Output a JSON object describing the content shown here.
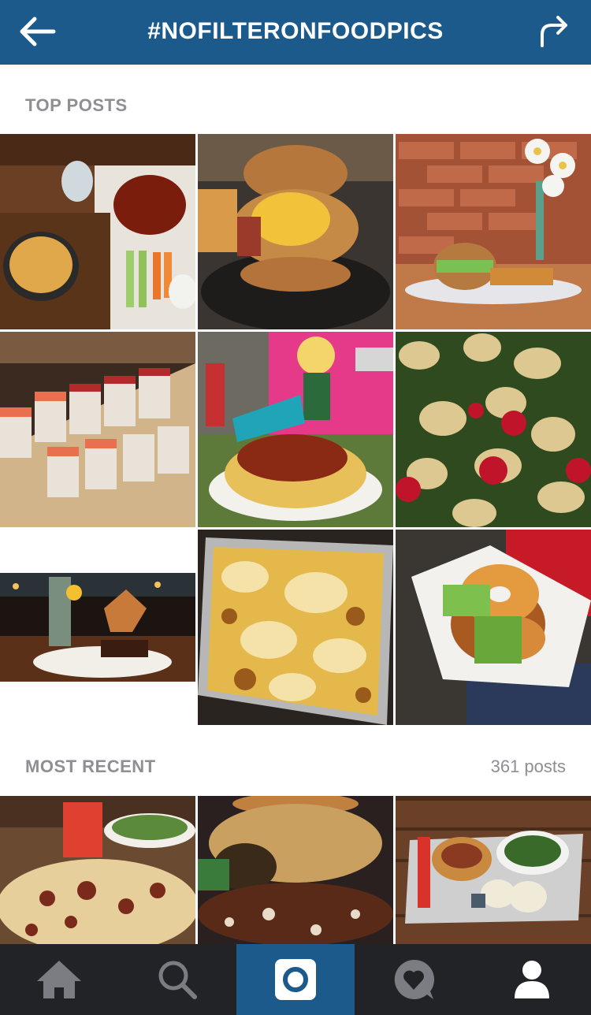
{
  "header": {
    "title": "#NOFILTERONFOODPICS",
    "back_icon": "arrow-left-icon",
    "share_icon": "share-arrow-icon",
    "bg_color": "#1c5a8c"
  },
  "top_posts": {
    "label": "TOP POSTS",
    "items": [
      {
        "subject": "wings, mac and cheese, celery"
      },
      {
        "subject": "fried chicken bacon cheeseburger"
      },
      {
        "subject": "burger with fries against brick wall"
      },
      {
        "subject": "sushi rolls platter"
      },
      {
        "subject": "mac and cheese at food truck"
      },
      {
        "subject": "tortellini spinach tomato salad"
      },
      {
        "subject": "dessert plate in restaurant"
      },
      {
        "subject": "baked cheese casserole in tray"
      },
      {
        "subject": "donut burger in hand"
      }
    ]
  },
  "most_recent": {
    "label": "MOST RECENT",
    "count": "361 posts",
    "items": [
      {
        "subject": "pizza with cocktail"
      },
      {
        "subject": "loaded burger with onion straws"
      },
      {
        "subject": "tacos, dumplings and soup on tray"
      }
    ]
  },
  "tabbar": {
    "tabs": [
      {
        "icon": "home-icon"
      },
      {
        "icon": "search-icon"
      },
      {
        "icon": "camera-icon",
        "active": true
      },
      {
        "icon": "activity-heart-icon"
      },
      {
        "icon": "profile-icon"
      }
    ],
    "bg_color": "#222326",
    "active_color": "#1c5a8c"
  }
}
